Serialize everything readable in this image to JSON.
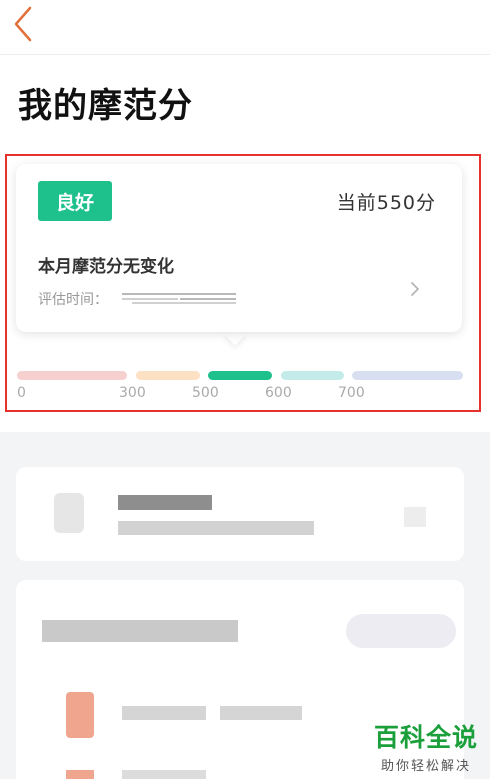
{
  "header": {
    "back_icon": "chevron-left-icon",
    "title": "我的摩范分"
  },
  "score_card": {
    "level_badge": "良好",
    "current_score": "当前550分",
    "month_status": "本月摩范分无变化",
    "evaluation_label": "评估时间：",
    "arrow_icon": "chevron-right-icon"
  },
  "score_scale": {
    "ticks": [
      "0",
      "300",
      "500",
      "600",
      "700"
    ],
    "active_segment": "500-600",
    "segment_colors": [
      "#f6cfcf",
      "#fbe0c4",
      "#1ec08c",
      "#c3ebe9",
      "#d8dff0"
    ]
  },
  "colors": {
    "accent_green": "#1ec08c",
    "highlight_red": "#e5322d",
    "watermark_green": "#1a9f3a"
  },
  "watermark": {
    "title": "百科全说",
    "subtitle": "助你轻松解决"
  }
}
